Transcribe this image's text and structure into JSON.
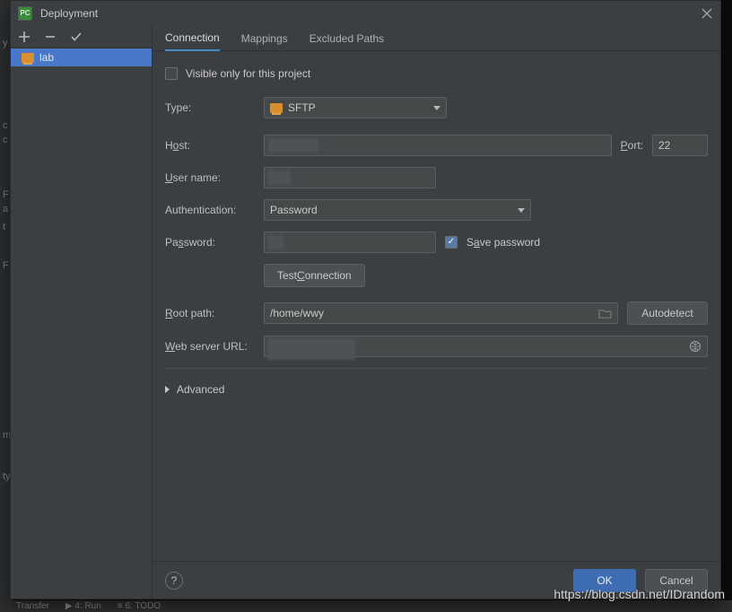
{
  "window": {
    "title": "Deployment",
    "app_badge": "PC"
  },
  "toolbar": {
    "add": "+",
    "remove": "−",
    "apply": "✓"
  },
  "tree": {
    "items": [
      {
        "label": "lab",
        "selected": true
      }
    ]
  },
  "tabs": {
    "connection": "Connection",
    "mappings": "Mappings",
    "excluded": "Excluded Paths"
  },
  "form": {
    "visible_label": "Visible only for this project",
    "visible_checked": false,
    "type_label": "Type:",
    "type_value": "SFTP",
    "host_label": "Host:",
    "host_value": "",
    "port_label": "Port:",
    "port_value": "22",
    "user_label": "User name:",
    "user_value": "",
    "auth_label": "Authentication:",
    "auth_value": "Password",
    "pass_label": "Password:",
    "pass_value": "",
    "save_pass_label": "Save password",
    "save_pass_checked": true,
    "test_conn": "Test Connection",
    "root_label": "Root path:",
    "root_value": "/home/wwy",
    "autodetect": "Autodetect",
    "web_label": "Web server URL:",
    "web_value": "",
    "advanced": "Advanced"
  },
  "footer": {
    "ok": "OK",
    "cancel": "Cancel"
  },
  "watermark": "https://blog.csdn.net/IDrandom",
  "bottomstrip": {
    "a": "Transfer",
    "b": "4: Run",
    "c": "6: TODO"
  }
}
